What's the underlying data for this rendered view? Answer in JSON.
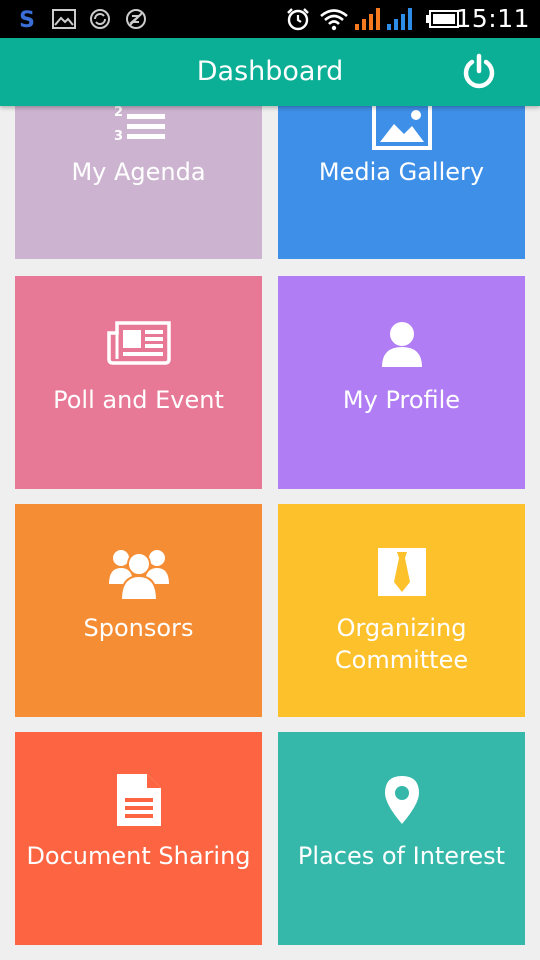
{
  "status_bar": {
    "time": "15:11",
    "icons": [
      "skype-icon",
      "image-icon",
      "sync-icon",
      "blocked-icon",
      "alarm-icon",
      "wifi-icon",
      "signal-icon",
      "signal-icon",
      "battery-icon"
    ]
  },
  "app_bar": {
    "title": "Dashboard",
    "background": "#0aaf95"
  },
  "tiles": [
    {
      "label_lines": [
        "My Agenda"
      ],
      "icon": "agenda-list-icon",
      "color": "#ccb4d0"
    },
    {
      "label_lines": [
        "Media Gallery"
      ],
      "icon": "image-icon",
      "color": "#3e8fe8"
    },
    {
      "label_lines": [
        "Poll and Event"
      ],
      "icon": "newspaper-icon",
      "color": "#e77896"
    },
    {
      "label_lines": [
        "My Profile"
      ],
      "icon": "user-icon",
      "color": "#b07df4"
    },
    {
      "label_lines": [
        "Sponsors"
      ],
      "icon": "group-icon",
      "color": "#f58d35"
    },
    {
      "label_lines": [
        "Organizing",
        "Committee"
      ],
      "icon": "tie-icon",
      "color": "#fdc12c"
    },
    {
      "label_lines": [
        "Document Sharing"
      ],
      "icon": "document-icon",
      "color": "#fd6441"
    },
    {
      "label_lines": [
        "Places of Interest"
      ],
      "icon": "location-pin-icon",
      "color": "#35b8aa"
    }
  ]
}
